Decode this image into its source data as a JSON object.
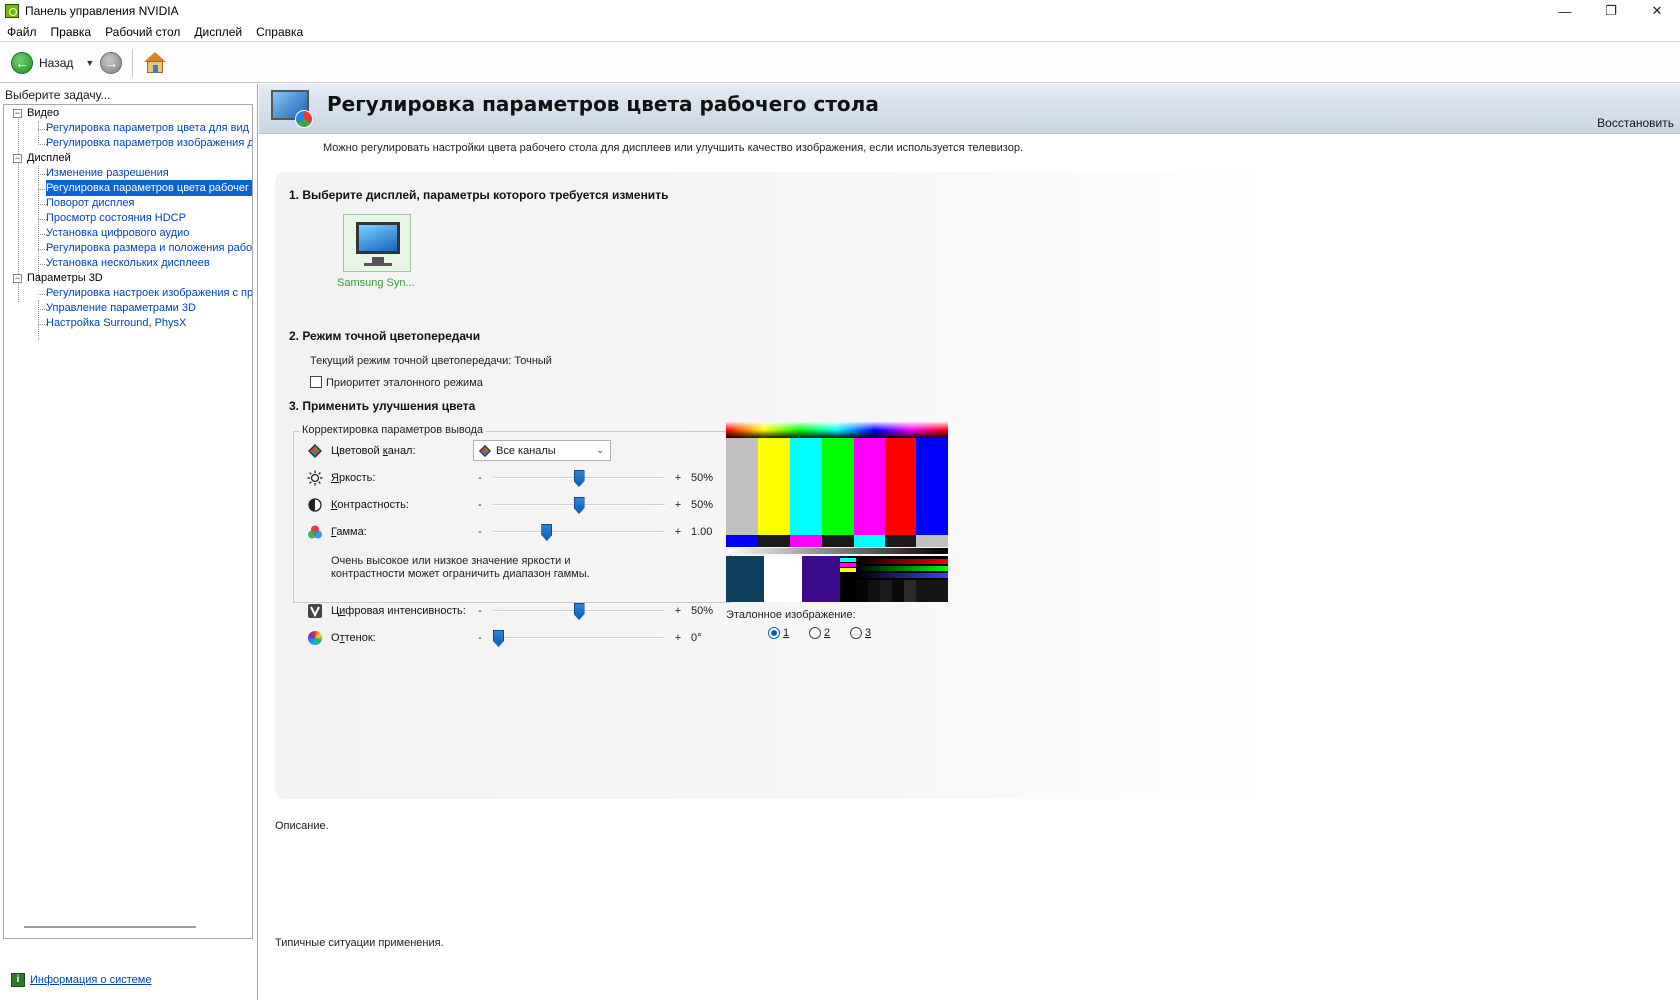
{
  "window": {
    "title": "Панель управления NVIDIA",
    "controls": {
      "minimize": "—",
      "maximize": "❐",
      "close": "✕"
    }
  },
  "menu": [
    "Файл",
    "Правка",
    "Рабочий стол",
    "Дисплей",
    "Справка"
  ],
  "toolbar": {
    "back_label": "Назад"
  },
  "sidebar": {
    "task_label": "Выберите задачу...",
    "tree": [
      {
        "label": "Видео",
        "children": [
          "Регулировка параметров цвета для вид",
          "Регулировка параметров изображения д"
        ]
      },
      {
        "label": "Дисплей",
        "children": [
          "Изменение разрешения",
          "Регулировка параметров цвета рабочег",
          "Поворот дисплея",
          "Просмотр состояния HDCP",
          "Установка цифрового аудио",
          "Регулировка размера и положения рабо",
          "Установка нескольких дисплеев"
        ]
      },
      {
        "label": "Параметры 3D",
        "children": [
          "Регулировка настроек изображения с пр",
          "Управление параметрами 3D",
          "Настройка Surround, PhysX"
        ]
      }
    ],
    "selected": "Регулировка параметров цвета рабочег",
    "system_info": "Информация о системе"
  },
  "main": {
    "title": "Регулировка параметров цвета рабочего стола",
    "restore": "Восстановить",
    "intro": "Можно регулировать настройки цвета рабочего стола для дисплеев или улучшить качество изображения, если используется телевизор.",
    "step1": "1. Выберите дисплей, параметры которого требуется изменить",
    "display_name": "Samsung Syn...",
    "step2": "2. Режим точной цветопередачи",
    "current_mode": "Текущий режим точной цветопередачи: Точный",
    "reference_priority": "Приоритет эталонного режима",
    "step3": "3. Применить улучшения цвета",
    "group_title": "Корректировка параметров вывода",
    "channel_label_pre": "Цветовой ",
    "channel_label_u": "к",
    "channel_label_post": "анал:",
    "channel_value": "Все каналы",
    "brightness": {
      "label_u": "Я",
      "label_rest": "ркость:",
      "minus": "-",
      "plus": "+",
      "value": "50%",
      "level": 0.5
    },
    "contrast": {
      "label_u": "К",
      "label_rest": "онтрастность:",
      "minus": "-",
      "plus": "+",
      "value": "50%",
      "level": 0.5
    },
    "gamma": {
      "label_u": "Г",
      "label_rest": "амма:",
      "minus": "-",
      "plus": "+",
      "value": "1.00",
      "level": 0.3
    },
    "warning_line1": "Очень высокое или низкое значение яркости и",
    "warning_line2": "контрастности может ограничить диапазон гаммы.",
    "vibrance": {
      "label_pre": "Ц",
      "label_u": "и",
      "label_rest": "фровая интенсивность:",
      "minus": "-",
      "plus": "+",
      "value": "50%",
      "level": 0.5
    },
    "hue": {
      "label_pre": "О",
      "label_u": "т",
      "label_rest": "тенок:",
      "minus": "-",
      "plus": "+",
      "value": "0°",
      "level": 0.0
    },
    "reference_image_label": "Эталонное изображение:",
    "reference_options": [
      "1",
      "2",
      "3"
    ],
    "reference_selected": "1",
    "description_label": "Описание.",
    "usage_label": "Типичные ситуации применения."
  },
  "colors": {
    "selection": "#0a64d2",
    "link": "#0044b3",
    "nvidia_green": "#76b900",
    "slider_thumb": "#0a5fb7"
  }
}
